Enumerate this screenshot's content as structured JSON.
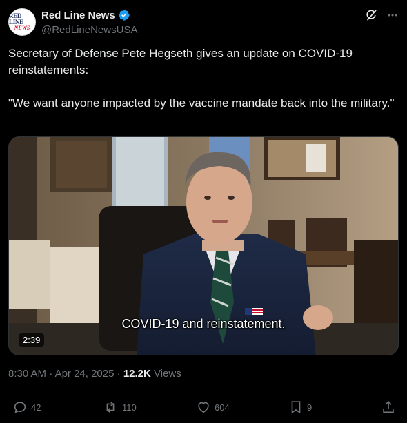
{
  "author": {
    "display_name": "Red Line News",
    "handle": "@RedLineNewsUSA",
    "avatar_text_line1": "RED LINE",
    "avatar_text_line2": "NEWS"
  },
  "tweet": {
    "text": "Secretary of Defense Pete Hegseth gives an update on COVID-19 reinstatements:\n\n\"We want anyone impacted by the vaccine mandate back into the military.\""
  },
  "media": {
    "caption": "COVID-19 and reinstatement.",
    "duration": "2:39"
  },
  "meta": {
    "time": "8:30 AM",
    "separator1": " · ",
    "date": "Apr 24, 2025",
    "separator2": " · ",
    "views_count": "12.2K",
    "views_label": " Views"
  },
  "actions": {
    "replies": "42",
    "reposts": "110",
    "likes": "604",
    "bookmarks": "9"
  },
  "icons": {
    "grok": "grok-icon",
    "more": "more-icon",
    "verified": "verified-badge-icon",
    "reply": "reply-icon",
    "repost": "repost-icon",
    "like": "heart-icon",
    "bookmark": "bookmark-icon",
    "share": "share-icon"
  },
  "colors": {
    "background": "#000000",
    "text": "#e7e9ea",
    "muted": "#71767b",
    "verified": "#1d9bf0"
  }
}
